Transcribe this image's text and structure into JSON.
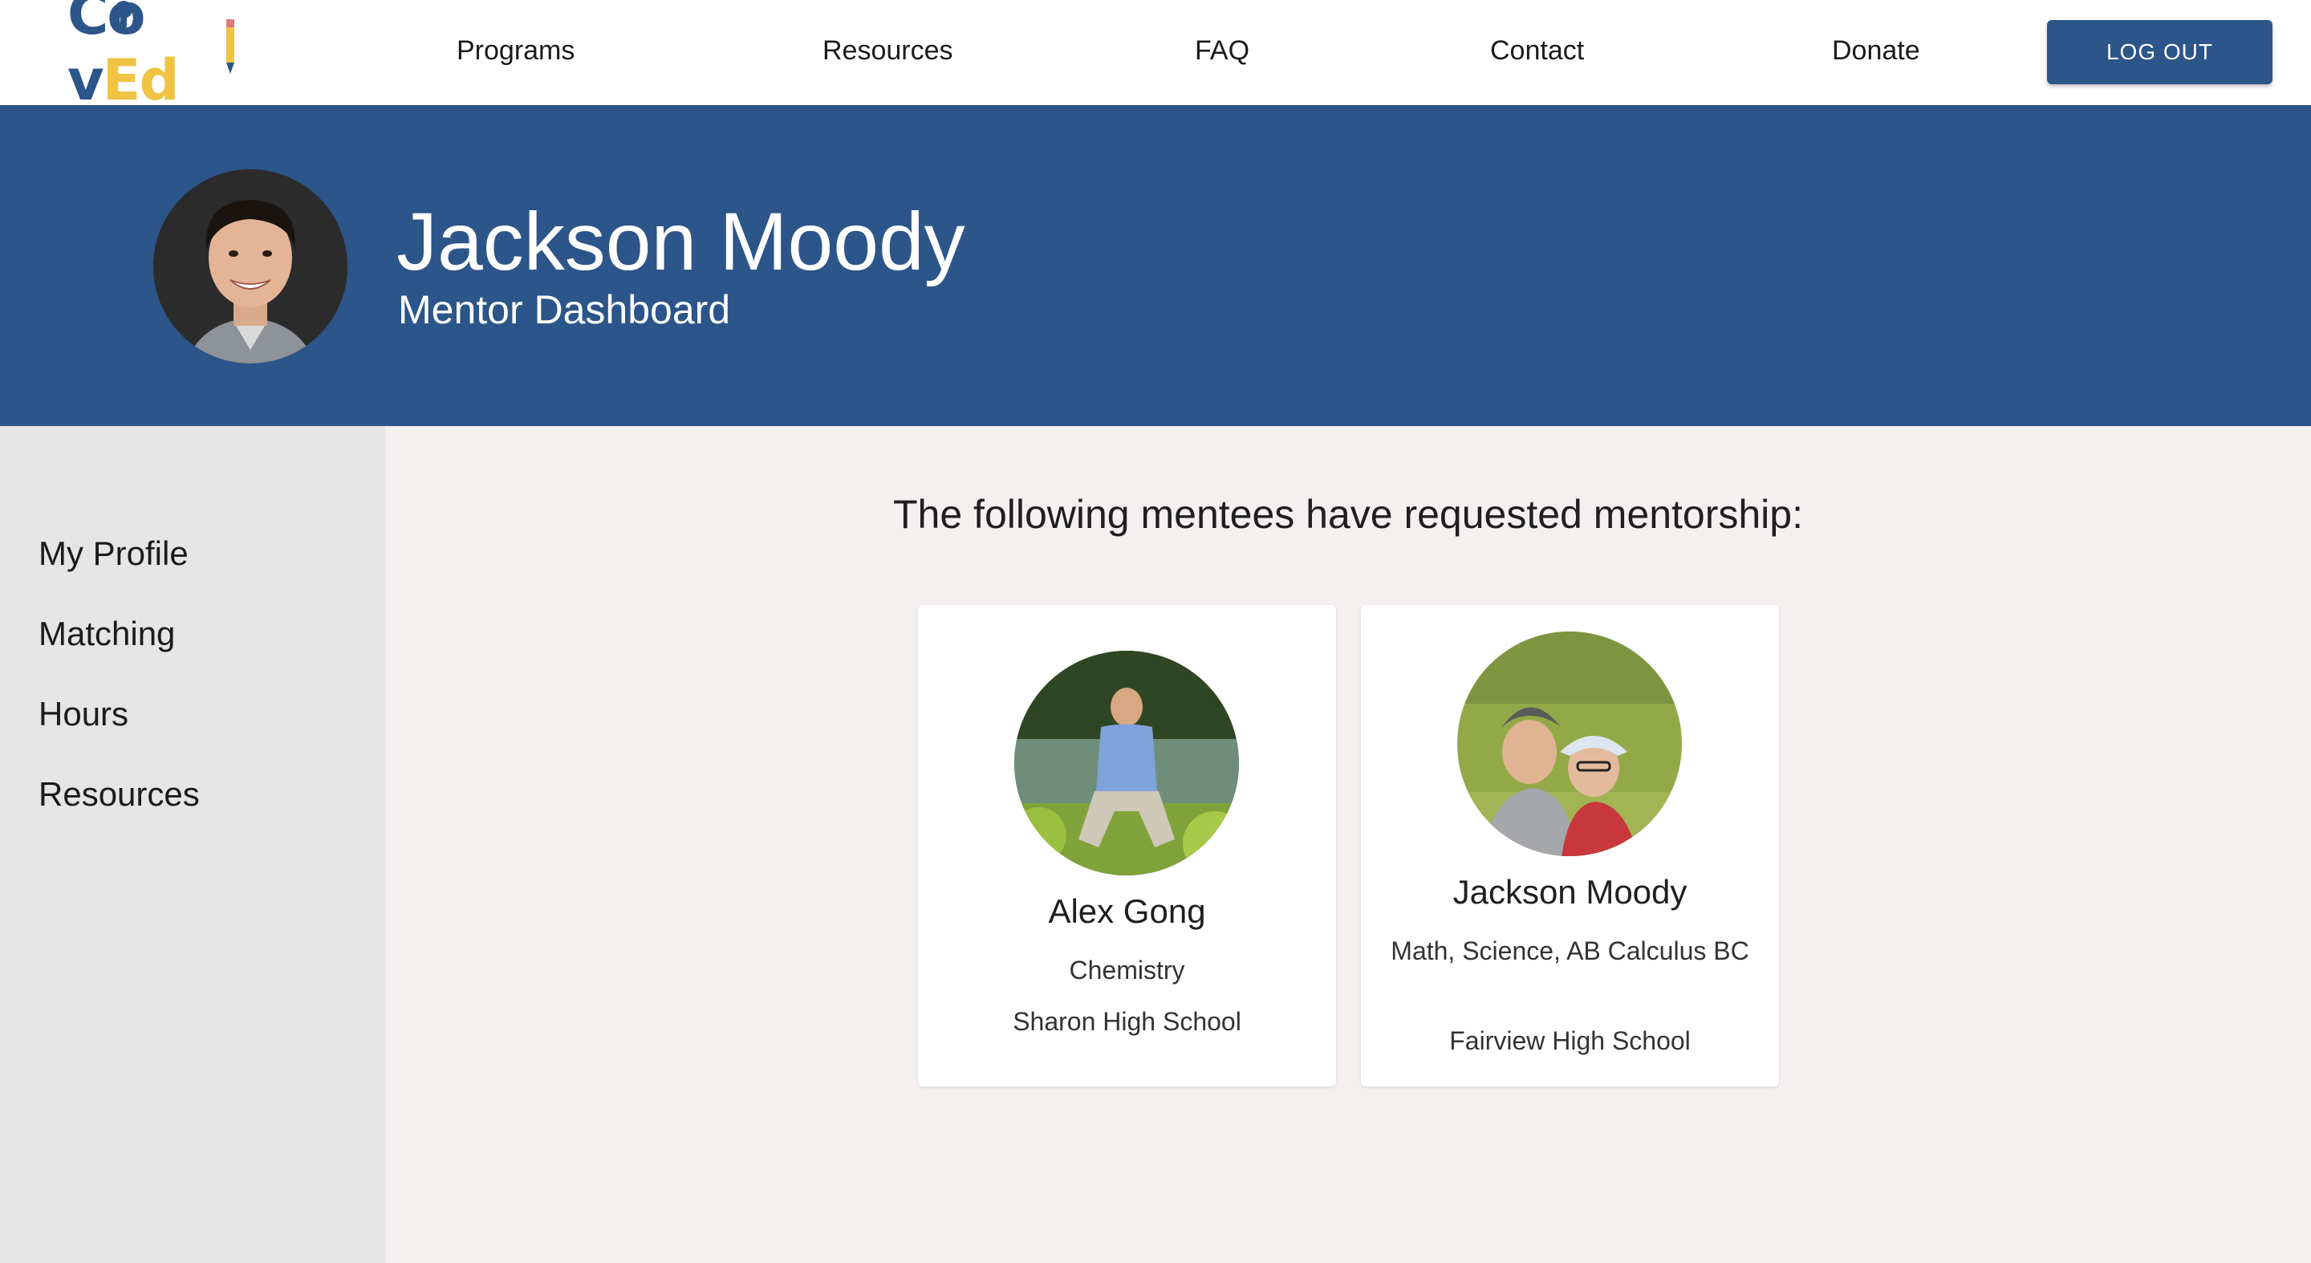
{
  "brand": {
    "logo_part1": "C",
    "logo_part2": "v",
    "logo_part3": "Ed",
    "primary_color": "#2c5589",
    "accent_color": "#f0c342"
  },
  "nav": {
    "items": [
      {
        "label": "Programs"
      },
      {
        "label": "Resources"
      },
      {
        "label": "FAQ"
      },
      {
        "label": "Contact"
      },
      {
        "label": "Donate"
      }
    ],
    "logout_label": "LOG OUT"
  },
  "banner": {
    "name": "Jackson Moody",
    "subtitle": "Mentor Dashboard"
  },
  "sidebar": {
    "items": [
      {
        "label": "My Profile"
      },
      {
        "label": "Matching"
      },
      {
        "label": "Hours"
      },
      {
        "label": "Resources"
      }
    ]
  },
  "main": {
    "heading": "The following mentees have requested mentorship:",
    "mentees": [
      {
        "name": "Alex Gong",
        "subjects": "Chemistry",
        "school": "Sharon High School"
      },
      {
        "name": "Jackson Moody",
        "subjects": "Math, Science, AB Calculus BC",
        "school": "Fairview High School"
      }
    ]
  }
}
